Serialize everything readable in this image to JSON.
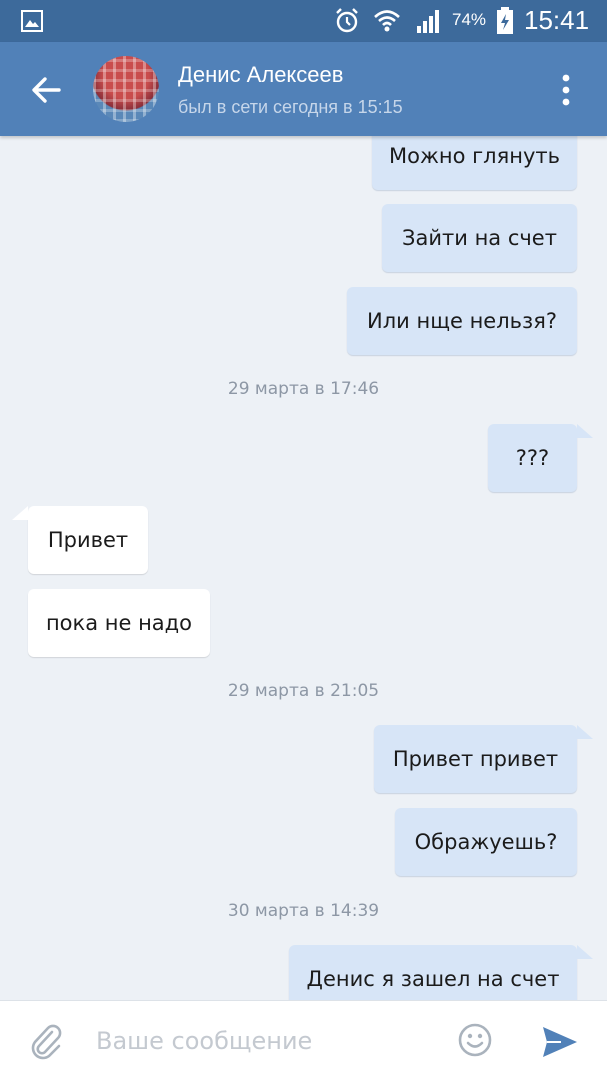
{
  "status_bar": {
    "battery_percent": "74%",
    "time": "15:41",
    "icons": [
      "gallery-notification-icon",
      "alarm-icon",
      "wifi-icon",
      "signal-icon",
      "battery-icon"
    ]
  },
  "header": {
    "contact_name": "Денис Алексеев",
    "contact_status": "был в сети сегодня в 15:15",
    "icons": [
      "back-arrow-icon",
      "avatar",
      "more-vertical-icon"
    ]
  },
  "messages": [
    {
      "type": "out",
      "text": "Можно глянуть"
    },
    {
      "type": "out",
      "text": "Зайти на счет"
    },
    {
      "type": "out",
      "text": "Или нще нельзя?"
    },
    {
      "type": "date",
      "text": "29 марта в 17:46"
    },
    {
      "type": "out",
      "text": "???"
    },
    {
      "type": "in",
      "text": "Привет"
    },
    {
      "type": "in",
      "text": "пока не надо"
    },
    {
      "type": "date",
      "text": "29 марта в 21:05"
    },
    {
      "type": "out",
      "text": "Привет привет"
    },
    {
      "type": "out",
      "text": "Ображуешь?"
    },
    {
      "type": "date",
      "text": "30 марта в 14:39"
    },
    {
      "type": "out",
      "text": "Денис я зашел на счет"
    }
  ],
  "composer": {
    "placeholder": "Ваше сообщение",
    "value": "",
    "icons": [
      "paperclip-icon",
      "emoji-icon",
      "send-icon"
    ]
  },
  "colors": {
    "status_bar": "#3d6a9b",
    "header": "#5181b8",
    "background": "#edf1f6",
    "outgoing_bubble": "#d7e5f7",
    "incoming_bubble": "#ffffff",
    "send_icon": "#5181b8"
  }
}
